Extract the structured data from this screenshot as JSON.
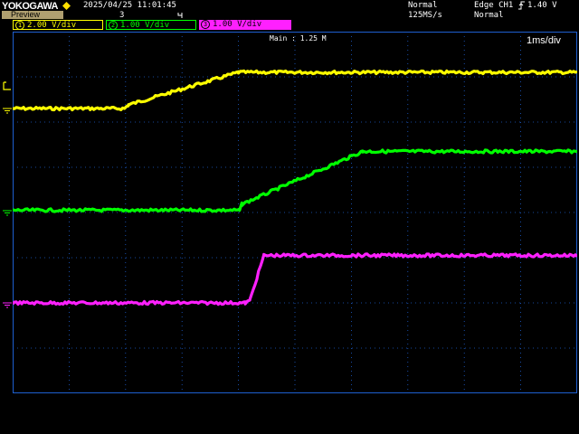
{
  "header": {
    "brand": "YOKOGAWA",
    "preview_label": "Preview",
    "datetime": "2025/04/25 11:01:45",
    "acq_count": "3",
    "acq_mode": "Normal",
    "sample_rate": "125MS/s",
    "trigger_type": "Edge CH1",
    "trigger_level": "1.40 V",
    "trigger_mode": "Normal"
  },
  "channels": [
    {
      "number": "1",
      "scale": "2.00 V/div",
      "color": "#ffff00"
    },
    {
      "number": "2",
      "scale": "1.00 V/div",
      "color": "#00ff00"
    },
    {
      "number": "3",
      "scale": "1.00 V/div",
      "color": "#ff20ff"
    }
  ],
  "display": {
    "main_label": "Main : 1.25 M",
    "timebase": "1ms/div",
    "grid_color": "#1e5fd0",
    "background": "#000000"
  },
  "icons": [
    "yokogawa-diamond-icon",
    "acq-marker-icon",
    "trigger-slope-icon",
    "trigger-level-marker-icon",
    "ground-marker-icon"
  ],
  "chart_data": {
    "type": "line",
    "x_range_div": [
      0,
      10
    ],
    "y_range_div": [
      -4,
      4
    ],
    "grid": true,
    "series": [
      {
        "channel": "1",
        "color": "#ffff00",
        "x": [
          0,
          1.98,
          2.05,
          4.0,
          10
        ],
        "y": [
          2.3,
          2.3,
          2.38,
          3.1,
          3.1
        ]
      },
      {
        "channel": "2",
        "color": "#00ff00",
        "x": [
          0,
          4.02,
          4.06,
          6.2,
          10
        ],
        "y": [
          0.05,
          0.05,
          0.18,
          1.35,
          1.35
        ]
      },
      {
        "channel": "3",
        "color": "#ff20ff",
        "x": [
          0,
          4.12,
          4.2,
          4.45,
          10
        ],
        "y": [
          -2.0,
          -2.0,
          -1.95,
          -0.95,
          -0.95
        ]
      }
    ]
  }
}
